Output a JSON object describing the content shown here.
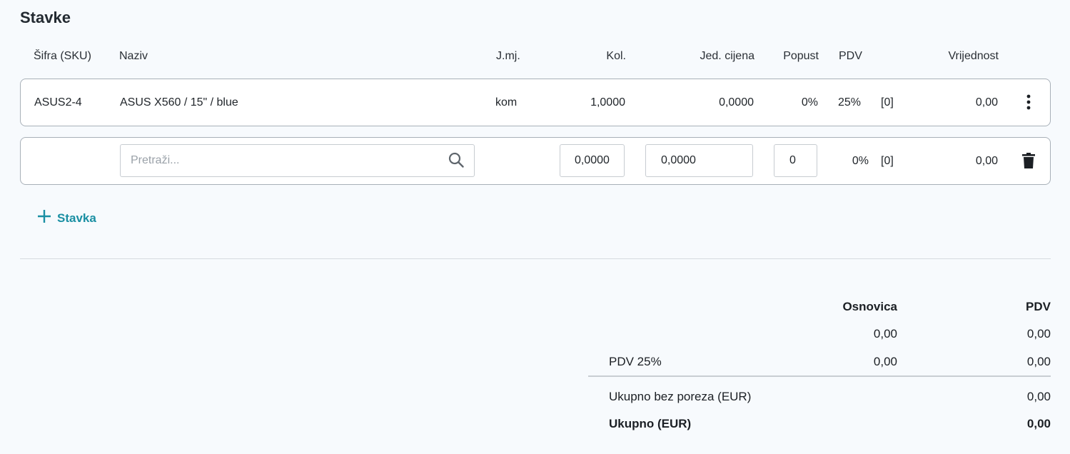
{
  "section_title": "Stavke",
  "columns": {
    "sku": "Šifra (SKU)",
    "name": "Naziv",
    "unit": "J.mj.",
    "qty": "Kol.",
    "unit_price": "Jed. cijena",
    "discount": "Popust",
    "vat": "PDV",
    "value": "Vrijednost"
  },
  "items": [
    {
      "sku": "ASUS2-4",
      "name": "ASUS X560 / 15\" / blue",
      "unit": "kom",
      "qty": "1,0000",
      "unit_price": "0,0000",
      "discount": "0%",
      "vat": "25%",
      "vat_code": "[0]",
      "value": "0,00"
    }
  ],
  "new_item": {
    "search_placeholder": "Pretraži...",
    "qty": "0,0000",
    "unit_price": "0,0000",
    "discount": "0",
    "vat": "0%",
    "vat_code": "[0]",
    "value": "0,00"
  },
  "add_item_label": "Stavka",
  "summary": {
    "header_base": "Osnovica",
    "header_vat": "PDV",
    "rows": [
      {
        "label": "",
        "base": "0,00",
        "vat": "0,00"
      },
      {
        "label": "PDV 25%",
        "base": "0,00",
        "vat": "0,00"
      }
    ],
    "total_excl_label": "Ukupno bez poreza (EUR)",
    "total_excl_value": "0,00",
    "total_label": "Ukupno (EUR)",
    "total_value": "0,00"
  },
  "colors": {
    "accent": "#1a8fa3",
    "border": "#a8b0b8",
    "background": "#f7fafd"
  }
}
